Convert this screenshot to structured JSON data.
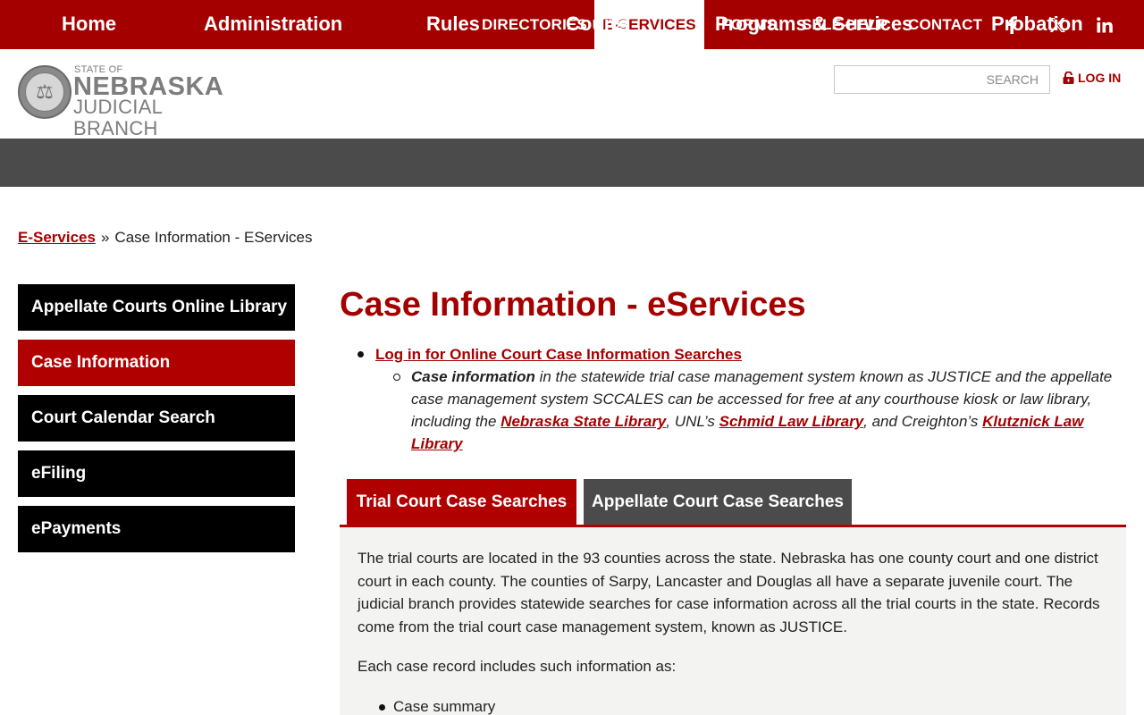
{
  "topbar": {
    "nav": [
      {
        "label": "DIRECTORIES",
        "active": false
      },
      {
        "label": "E-SERVICES",
        "active": true
      },
      {
        "label": "FORMS",
        "active": false
      },
      {
        "label": "SELF-HELP",
        "active": false
      },
      {
        "label": "CONTACT",
        "active": false
      }
    ],
    "social": [
      {
        "icon": "facebook-icon",
        "glyph": "f"
      },
      {
        "icon": "x-icon",
        "glyph": "𝕏"
      },
      {
        "icon": "linkedin-icon",
        "glyph": "in"
      }
    ],
    "accent_color": "#a50000"
  },
  "header": {
    "logo": {
      "state_of": "STATE OF",
      "state": "NEBRASKA",
      "branch": "JUDICIAL BRANCH"
    },
    "search": {
      "placeholder": "SEARCH"
    },
    "login_label": "LOG IN"
  },
  "mainnav": {
    "items": [
      "Home",
      "Administration",
      "Rules",
      "Courts",
      "Programs & Services",
      "Probation"
    ],
    "background": "#4b4b4b"
  },
  "breadcrumb": {
    "parent": "E-Services",
    "separator": "»",
    "current": "Case Information - EServices"
  },
  "sidebar": {
    "items": [
      {
        "label": "Appellate Courts Online Library",
        "active": false
      },
      {
        "label": "Case Information",
        "active": true
      },
      {
        "label": "Court Calendar Search",
        "active": false
      },
      {
        "label": "eFiling",
        "active": false
      },
      {
        "label": "ePayments",
        "active": false
      }
    ]
  },
  "main": {
    "title": "Case Information - eServices",
    "intro_link": "Log in for Online Court Case Information Searches",
    "sub_bullet": {
      "bold_lead": "Case information",
      "text_1": " in the statewide trial case management system known as JUSTICE and the appellate case management system SCCALES can be accessed for free at any courthouse kiosk or law library, including the ",
      "link_1": "Nebraska State Library",
      "text_2": ", UNL’s ",
      "link_2": "Schmid Law Library",
      "text_3": ", and Creighton’s ",
      "link_3": "Klutznick Law Library"
    },
    "tabs": [
      {
        "label": "Trial Court Case Searches",
        "active": true
      },
      {
        "label": "Appellate Court Case Searches",
        "active": false
      }
    ],
    "panel": {
      "paragraph_1": "The trial courts are located in the 93 counties across the state.  Nebraska has one county court and one district court in each county.  The counties of Sarpy, Lancaster and Douglas all have a separate juvenile court.  The judicial branch provides statewide searches for case information across all the trial courts in the state.  Records come from the trial court case management system, known as JUSTICE.",
      "paragraph_2": "Each case record includes such information as:",
      "list": [
        "Case summary"
      ]
    }
  }
}
